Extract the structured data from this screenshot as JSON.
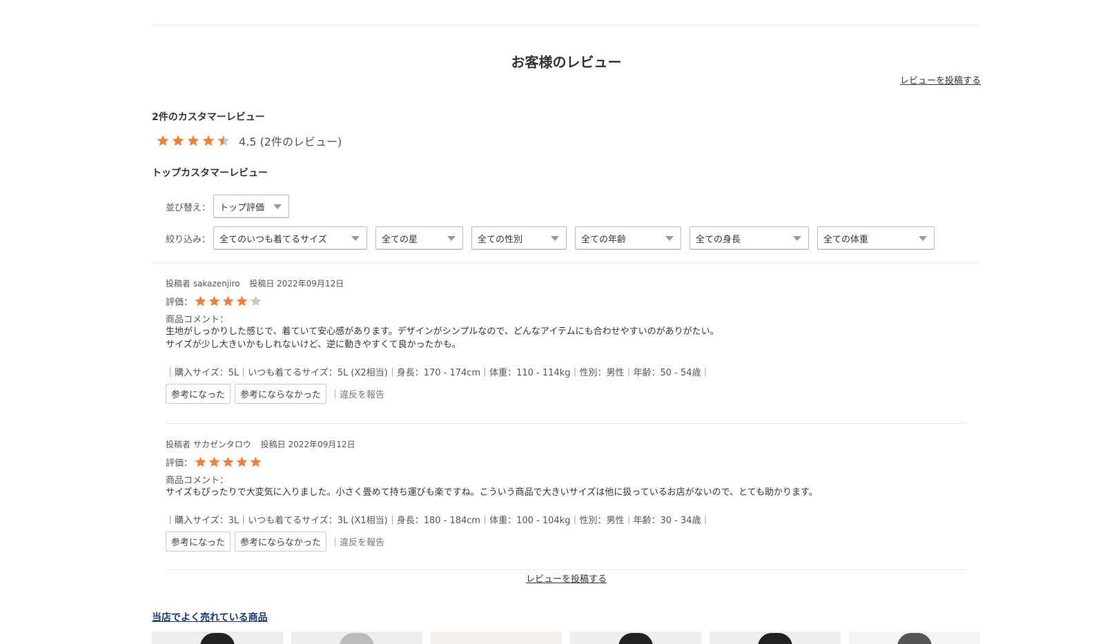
{
  "header": {
    "title": "お客様のレビュー",
    "post_review_link": "レビューを投稿する"
  },
  "summary": {
    "count_title": "2件のカスタマーレビュー",
    "average_rating": 4.5,
    "rating_text": "4.5 (2件のレビュー)",
    "top_reviews_title": "トップカスタマーレビュー"
  },
  "sort": {
    "label": "並び替え：",
    "selected": "トップ評価"
  },
  "filters": {
    "label": "絞り込み：",
    "size": "全てのいつも着てるサイズ",
    "stars": "全ての星",
    "gender": "全ての性別",
    "age": "全ての年齢",
    "height": "全ての身長",
    "weight": "全ての体重"
  },
  "reviews": [
    {
      "poster_label": "投稿者 sakazenjiro",
      "date_label": "投稿日 2022年09月12日",
      "rating_label": "評価：",
      "rating": 4,
      "comment_label": "商品コメント：",
      "comment_line1": "生地がしっかりした感じで、着ていて安心感があります。デザインがシンプルなので、どんなアイテムにも合わせやすいのがありがたい。",
      "comment_line2": "サイズが少し大きいかもしれないけど、逆に動きやすくて良かったかも。",
      "attributes": "｜購入サイズ：5L｜いつも着てるサイズ：5L (X2相当)｜身長：170 - 174cm｜体重：110 - 114kg｜性別：男性｜年齢：50 - 54歳｜",
      "helpful_label": "参考になった",
      "not_helpful_label": "参考にならなかった",
      "report_label": "｜違反を報告"
    },
    {
      "poster_label": "投稿者 サカゼンタロウ",
      "date_label": "投稿日 2022年09月12日",
      "rating_label": "評価：",
      "rating": 5,
      "comment_label": "商品コメント：",
      "comment_line1": "サイズもぴったりで大変気に入りました。小さく畳めて持ち運びも楽ですね。こういう商品で大きいサイズは他に扱っているお店がないので、とても助かります。",
      "attributes": "｜購入サイズ：3L｜いつも着てるサイズ：3L (X1相当)｜身長：180 - 184cm｜体重：100 - 104kg｜性別：男性｜年齢：30 - 34歳｜",
      "helpful_label": "参考になった",
      "not_helpful_label": "参考にならなかった",
      "report_label": "｜違反を報告"
    }
  ],
  "footer": {
    "post_review_link": "レビューを投稿する",
    "best_sellers_title": "当店でよく売れている商品"
  },
  "colors": {
    "star_filled": "#f0813a",
    "star_empty": "#c8c8c8",
    "link_dark": "#1a3a6e"
  },
  "icons": [
    "star-icon",
    "half-star-icon",
    "chevron-down-icon"
  ]
}
